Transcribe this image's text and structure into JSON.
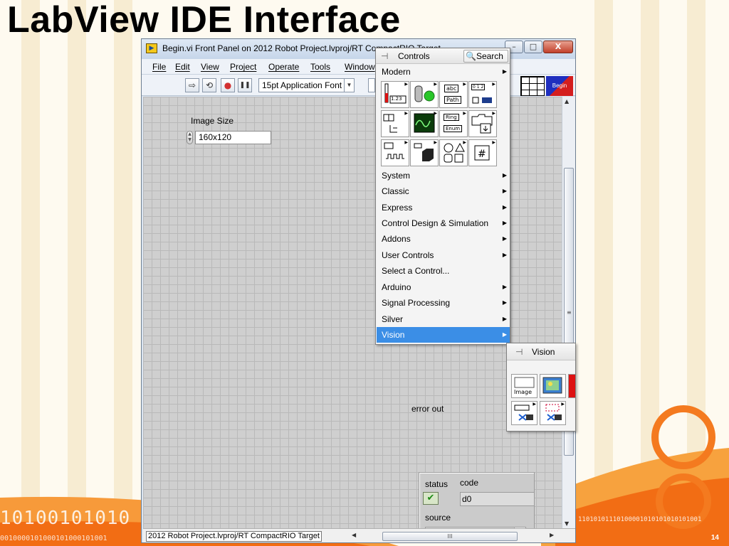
{
  "slide": {
    "title": "LabView IDE Interface",
    "page_number": "14",
    "binary_left": "10100101010",
    "binary_left_small": "0010000101000101000101001",
    "binary_right": "11010101110100001010101010101001"
  },
  "window": {
    "title": "Begin.vi Front Panel on 2012 Robot Project.lvproj/RT CompactRIO Target",
    "minimize": "–",
    "maximize": "□",
    "close": "X"
  },
  "menu": {
    "items": [
      "File",
      "Edit",
      "View",
      "Project",
      "Operate",
      "Tools",
      "Window"
    ]
  },
  "toolbar": {
    "run_icon": "⇨",
    "run_continuous_icon": "⟲",
    "abort_icon": "●",
    "pause_icon": "❚❚",
    "font_label": "15pt Application Font",
    "font_arrow": "▼",
    "vi_icon_label": "Begin"
  },
  "front_panel": {
    "image_size_label": "Image Size",
    "image_size_value": "160x120",
    "error_out_label": "error out",
    "status_label": "status",
    "code_label": "code",
    "code_value": "d0",
    "source_label": "source",
    "status_check": "✔"
  },
  "statusbar": {
    "path": "2012 Robot Project.lvproj/RT CompactRIO Target",
    "grip": "III"
  },
  "controls_palette": {
    "title": "Controls",
    "search_label": "Search",
    "modern_label": "Modern",
    "categories": [
      "System",
      "Classic",
      "Express",
      "Control Design & Simulation",
      "Addons",
      "User Controls",
      "Select a Control...",
      "Arduino",
      "Signal Processing",
      "Silver",
      "Vision"
    ],
    "submenu_arrow": "▶",
    "icons": {
      "numeric_label": "1.23",
      "string_label": "abc",
      "path_label": "Path",
      "array_label": "0 1 2",
      "ring_label": "Ring",
      "enum_label": "Enum"
    }
  },
  "vision_palette": {
    "title": "Vision",
    "image_icon_label": "Image"
  },
  "colors": {
    "selection": "#3b8ee6",
    "panel_bg": "#cfcfcf",
    "slide_accent": "#f47a1f"
  }
}
